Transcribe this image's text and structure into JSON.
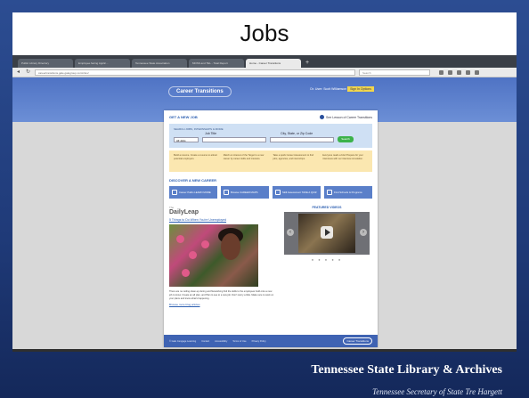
{
  "slide": {
    "title": "Jobs",
    "footer_brand": "Tennessee State Library & Archives",
    "footer_subtitle": "Tennessee Secretary of State Tre Hargett"
  },
  "browser": {
    "tabs": [
      "Public Library Directory",
      "Employee facing Applic...",
      "Tennessee State Association",
      "MOSS and TEL - Total Report",
      "Home - Career Transitions"
    ],
    "active_tab_index": 4,
    "url": "careertransitions.gale.galegroup.com/ctus/",
    "search_placeholder": "Search"
  },
  "site": {
    "logo": "Career Transitions",
    "header_text": "Dr. User: Scott Williamson",
    "header_highlight": "Sign In Options",
    "get_new_job": "GET A NEW JOB",
    "info_link": "See Lesson of Career Transitions",
    "search_title": "SEARCH JOBS, INTERNSHIPS & MORE",
    "job_title_label": "Job Title",
    "location_label": "City, State, or Zip Code",
    "select_value": "All Jobs",
    "search_button": "Search",
    "tips": [
      "Build a resume. Create a resume to attract potential employers.",
      "Match an interest of the Target to a new career by career skills and interests.",
      "Take a quick Career Assessment to find jobs, agencies, and internships.",
      "Everyone reads a brief Prepare for your interviews with our interview simulation."
    ],
    "discover_heading": "DISCOVER A NEW CAREER",
    "discover_buttons": [
      "Career Paths LEARN MORE",
      "Browse CAREER MAPS",
      "Skill Assessment TAKE A QUIZ",
      "Find Schools & Programs"
    ],
    "daily_leap_small": "The",
    "daily_leap": "DailyLeap",
    "article_title": "5 Things to Do When You're Unemployed",
    "article_blurb": "There are no ceiling clean-up during and Networking find the skills to the employees hold onto a new job to know, Create an all plan, and Plan to see to a new job. Don't worry a little. Make sure to work on your plans and know what's happening.",
    "more_link": "Browse more blog articles",
    "featured_videos": "FEATURED VIDEOS",
    "footer_links": [
      "© Gale Cengage Learning",
      "Contact",
      "Accessibility",
      "Terms of Use",
      "Privacy Policy"
    ],
    "footer_logo": "Career Transitions"
  },
  "colors": {
    "slide_bg": "#1f3a78",
    "header_blue": "#4f73c4",
    "search_green": "#3cb24a",
    "tips_bg": "#fbe7b0"
  }
}
